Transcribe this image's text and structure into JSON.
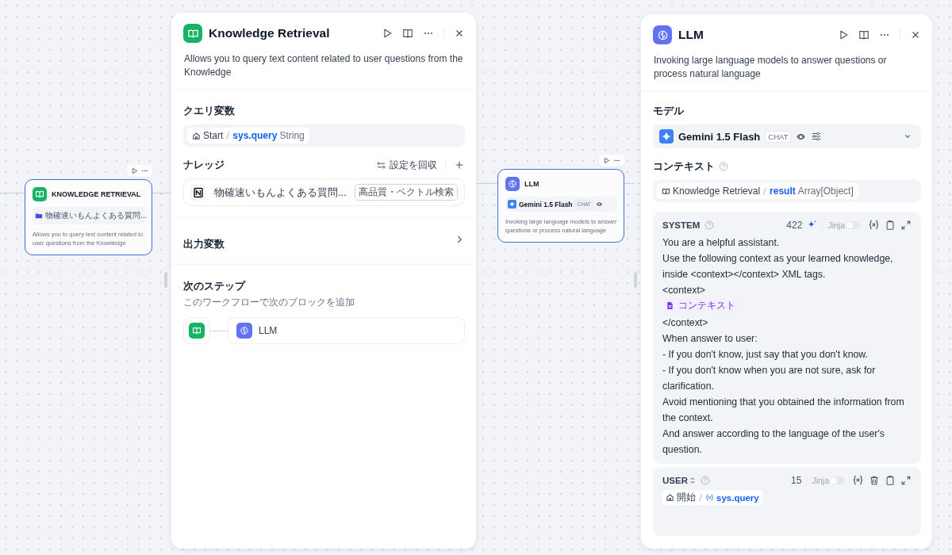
{
  "left": {
    "node": {
      "title": "KNOWLEDGE RETRIEVAL",
      "dataset": "物確速いもんよくある質問...",
      "description": "Allows you to query text content related to user questions from the Knowledge"
    },
    "panel": {
      "title": "Knowledge Retrieval",
      "description": "Allows you to query text content related to user questions from the Knowledge",
      "query_variable": {
        "label": "クエリ変数",
        "node": "Start",
        "variable": "sys.query",
        "type": "String"
      },
      "knowledge": {
        "label": "ナレッジ",
        "recall_settings": "設定を回収",
        "items": [
          {
            "name": "物確速いもんよくある質問...",
            "tag": "高品質・ベクトル検索"
          }
        ]
      },
      "output_variables": {
        "label": "出力変数",
        "expanded": false
      },
      "next_step": {
        "label": "次のステップ",
        "hint": "このワークフローで次のブロックを追加",
        "items": [
          {
            "name": "LLM"
          }
        ]
      }
    }
  },
  "right": {
    "node": {
      "title": "LLM",
      "model": "Gemini 1.5 Flash",
      "mode": "CHAT",
      "description": "Invoking large language models to answer questions or process natural language"
    },
    "panel": {
      "title": "LLM",
      "description": "Invoking large language models to answer questions or process natural language",
      "model": {
        "label": "モデル",
        "name": "Gemini 1.5 Flash",
        "mode": "CHAT"
      },
      "context": {
        "label": "コンテキスト",
        "node": "Knowledge Retrieval",
        "variable": "result",
        "type": "Array[Object]"
      },
      "prompts": [
        {
          "role": "SYSTEM",
          "kind": "system",
          "count": "422",
          "jinja_label": "Jinja",
          "jinja": false,
          "blocks": [
            {
              "kind": "text",
              "text": "You are a helpful assistant."
            },
            {
              "kind": "text",
              "text": "Use the following context as your learned knowledge, inside <context></context> XML tags."
            },
            {
              "kind": "text",
              "text": "<context>"
            },
            {
              "kind": "chip",
              "text": "コンテキスト"
            },
            {
              "kind": "text",
              "text": "</context>"
            },
            {
              "kind": "text",
              "text": "When answer to user:"
            },
            {
              "kind": "text",
              "text": "- If you don't know, just say that you don't know."
            },
            {
              "kind": "text",
              "text": "- If you don't know when you are not sure, ask for clarification."
            },
            {
              "kind": "text",
              "text": "Avoid mentioning that you obtained the information from the context."
            },
            {
              "kind": "text",
              "text": "And answer according to the language of the user's question."
            }
          ]
        },
        {
          "role": "USER",
          "kind": "user",
          "count": "15",
          "jinja_label": "Jinja",
          "jinja": false,
          "blocks": [
            {
              "kind": "var",
              "node": "開始",
              "variable": "sys.query"
            }
          ]
        }
      ]
    }
  }
}
